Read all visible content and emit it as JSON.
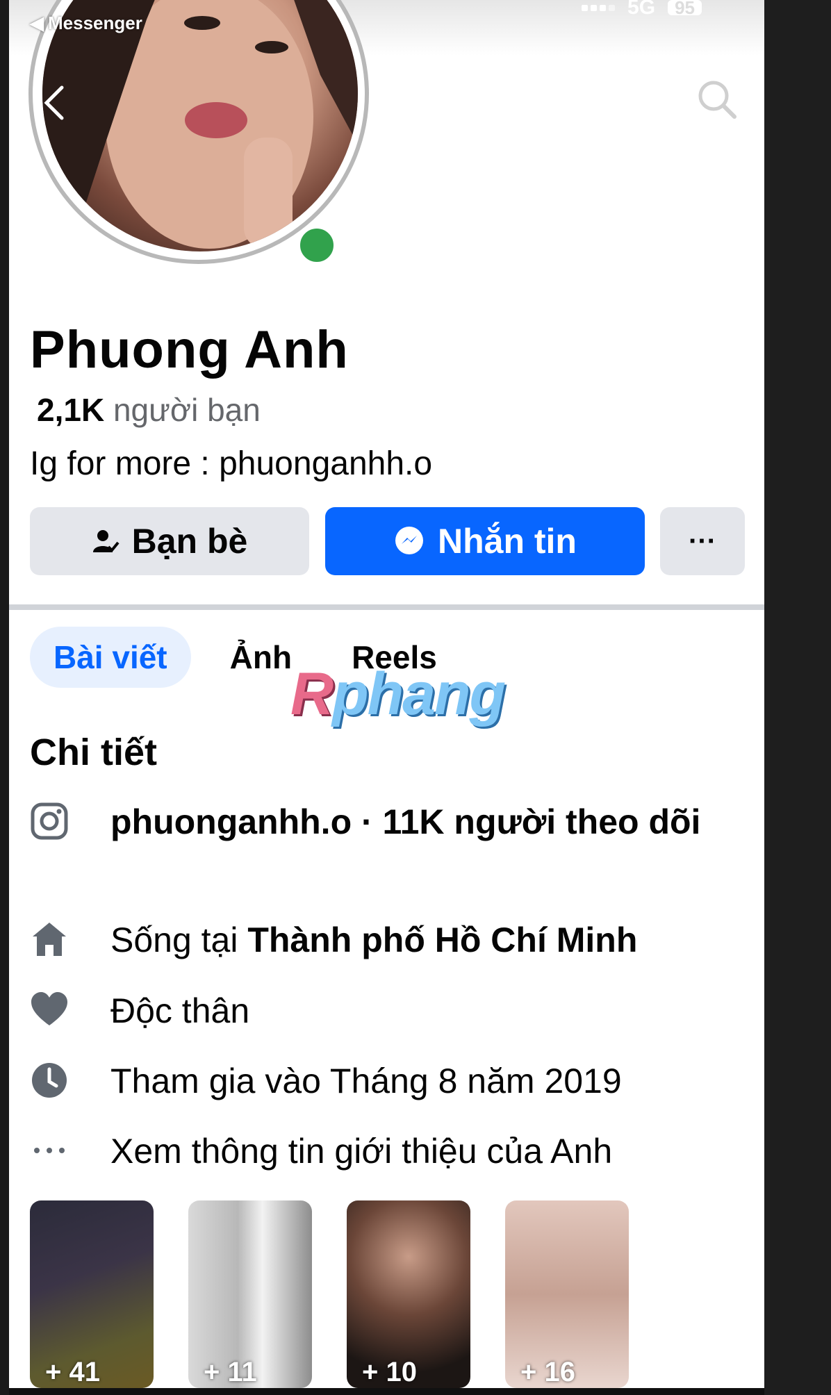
{
  "status_bar": {
    "back_app": "Messenger",
    "network": "5G",
    "battery": "95"
  },
  "profile": {
    "name": "Phuong Anh",
    "friends_count": "2,1K",
    "friends_label": "người bạn",
    "bio": "Ig for more : phuonganhh.o",
    "online": true
  },
  "actions": {
    "friends_button": "Bạn bè",
    "message_button": "Nhắn tin",
    "more_button": "···"
  },
  "tabs": [
    {
      "label": "Bài viết",
      "active": true
    },
    {
      "label": "Ảnh",
      "active": false
    },
    {
      "label": "Reels",
      "active": false
    }
  ],
  "watermark": {
    "first": "R",
    "rest": "phang"
  },
  "details": {
    "title": "Chi tiết",
    "instagram": "phuonganhh.o · 11K người theo dõi",
    "lives_prefix": "Sống tại ",
    "lives_city": "Thành phố Hồ Chí Minh",
    "relationship": "Độc thân",
    "joined": "Tham gia vào Tháng 8 năm 2019",
    "see_about": "Xem thông tin giới thiệu của Anh"
  },
  "photo_albums": [
    {
      "count": "+ 41"
    },
    {
      "count": "+ 11"
    },
    {
      "count": "+ 10"
    },
    {
      "count": "+ 16"
    }
  ],
  "colors": {
    "accent": "#0866ff",
    "online": "#31a24c",
    "secondary_text": "#65676b"
  }
}
